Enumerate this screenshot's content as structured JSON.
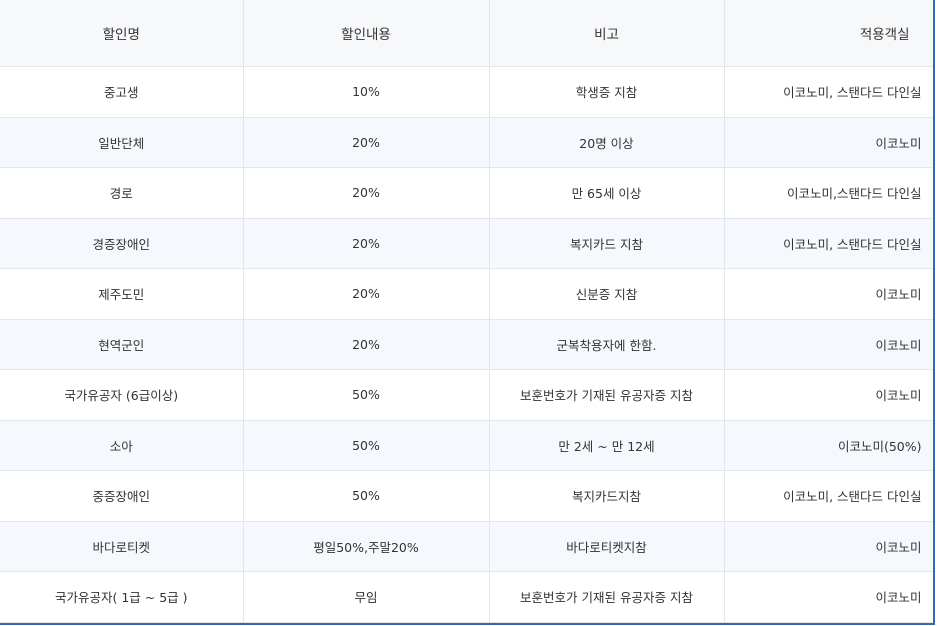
{
  "table": {
    "headers": [
      "할인명",
      "할인내용",
      "비고",
      "적용객실"
    ],
    "rows": [
      {
        "name": "중고생",
        "discount": "10%",
        "note": "학생증 지참",
        "rooms": "이코노미, 스탠다드 다인실"
      },
      {
        "name": "일반단체",
        "discount": "20%",
        "note": "20명 이상",
        "rooms": "이코노미"
      },
      {
        "name": "경로",
        "discount": "20%",
        "note": "만 65세 이상",
        "rooms": "이코노미,스탠다드 다인실"
      },
      {
        "name": "경증장애인",
        "discount": "20%",
        "note": "복지카드 지참",
        "rooms": "이코노미, 스탠다드 다인실"
      },
      {
        "name": "제주도민",
        "discount": "20%",
        "note": "신분증 지참",
        "rooms": "이코노미"
      },
      {
        "name": "현역군인",
        "discount": "20%",
        "note": "군복착용자에 한함.",
        "rooms": "이코노미"
      },
      {
        "name": "국가유공자 (6급이상)",
        "discount": "50%",
        "note": "보훈번호가 기재된 유공자증 지참",
        "rooms": "이코노미"
      },
      {
        "name": "소아",
        "discount": "50%",
        "note": "만 2세 ~ 만 12세",
        "rooms": "이코노미(50%)"
      },
      {
        "name": "중증장애인",
        "discount": "50%",
        "note": "복지카드지참",
        "rooms": "이코노미, 스탠다드 다인실"
      },
      {
        "name": "바다로티켓",
        "discount": "평일50%,주말20%",
        "note": "바다로티켓지참",
        "rooms": "이코노미"
      },
      {
        "name": "국가유공자( 1급 ~ 5급 )",
        "discount": "무임",
        "note": "보훈번호가 기재된 유공자증 지참",
        "rooms": "이코노미"
      }
    ]
  },
  "colors": {
    "frame_border": "#2f6cb5",
    "header_bg": "#f7f8fa",
    "alt_row_bg": "#f5f8fd",
    "grid_line": "#e3e6eb",
    "text": "#333333"
  }
}
